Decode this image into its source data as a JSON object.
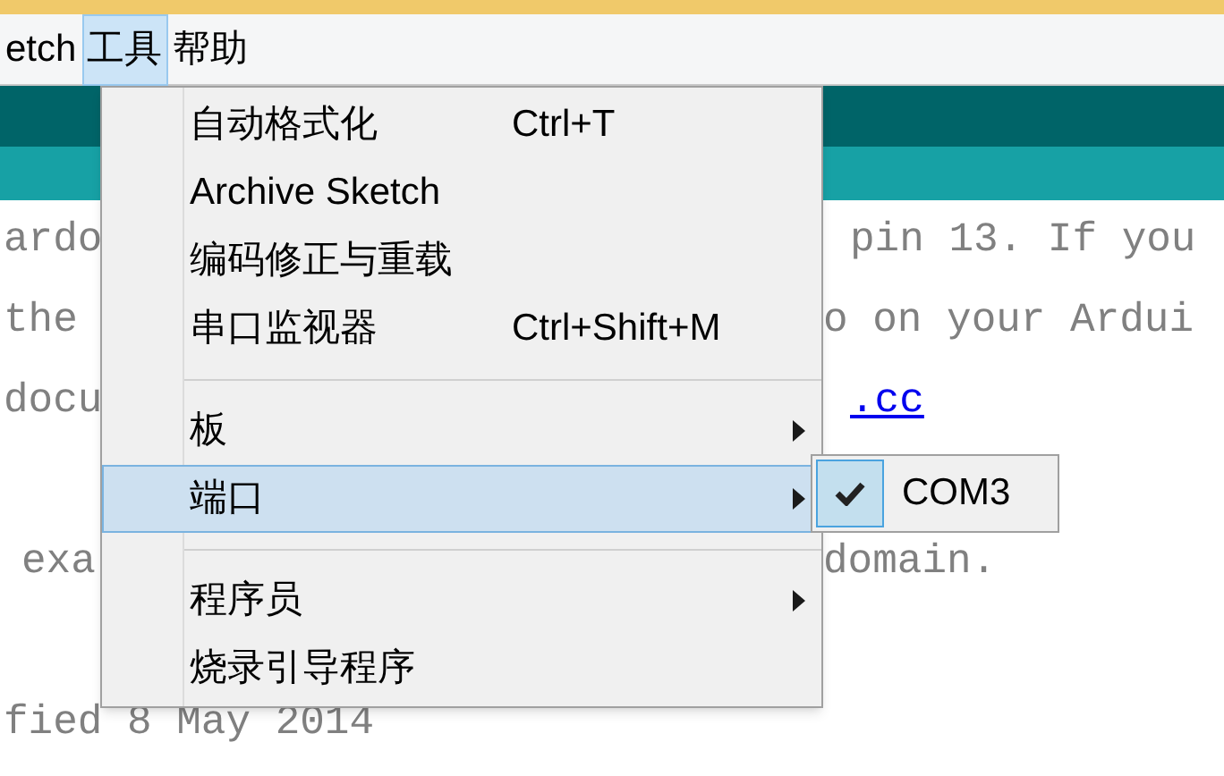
{
  "menubar": [
    {
      "label": "etch",
      "selected": false
    },
    {
      "label": "工具",
      "selected": true
    },
    {
      "label": "帮助",
      "selected": false
    }
  ],
  "editor_lines": [
    {
      "kind": "text",
      "left": "ardo",
      "right": "pin 13. If you",
      "right_link": false
    },
    {
      "kind": "text",
      "left": "the",
      "right": "o on your Ardui",
      "right_link": false
    },
    {
      "kind": "text",
      "left": "docu",
      "right": ".cc",
      "right_link": true
    },
    {
      "kind": "blank"
    },
    {
      "kind": "text",
      "left": "exa",
      "right": "domain.",
      "right_link": false
    },
    {
      "kind": "blank"
    },
    {
      "kind": "text",
      "left": "fied 8 May 2014"
    }
  ],
  "menu": [
    {
      "kind": "item",
      "label": "自动格式化",
      "shortcut": "Ctrl+T",
      "selected": false,
      "submenu": false
    },
    {
      "kind": "item",
      "label": "Archive Sketch",
      "selected": false,
      "submenu": false
    },
    {
      "kind": "item",
      "label": "编码修正与重载",
      "selected": false,
      "submenu": false
    },
    {
      "kind": "item",
      "label": "串口监视器",
      "shortcut": "Ctrl+Shift+M",
      "selected": false,
      "submenu": false
    },
    {
      "kind": "separator"
    },
    {
      "kind": "item",
      "label": "板",
      "selected": false,
      "submenu": true
    },
    {
      "kind": "item",
      "label": "端口",
      "selected": true,
      "submenu": true
    },
    {
      "kind": "separator"
    },
    {
      "kind": "item",
      "label": "程序员",
      "selected": false,
      "submenu": true
    },
    {
      "kind": "item",
      "label": "烧录引导程序",
      "selected": false,
      "submenu": false
    }
  ],
  "submenu": [
    {
      "label": "COM3",
      "checked": true
    }
  ]
}
